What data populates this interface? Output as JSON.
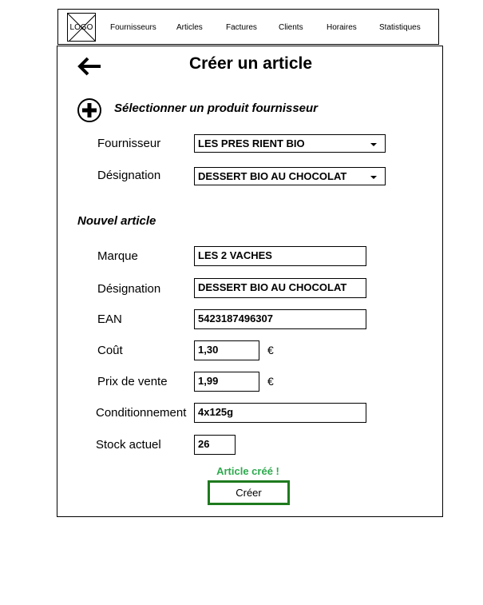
{
  "nav": {
    "logo": "LOGO",
    "items": [
      "Fournisseurs",
      "Articles",
      "Factures",
      "Clients",
      "Horaires",
      "Statistiques"
    ]
  },
  "page": {
    "title": "Créer un article"
  },
  "supplier_section": {
    "title": "Sélectionner un produit fournisseur",
    "fournisseur_label": "Fournisseur",
    "fournisseur_value": "LES PRES RIENT BIO",
    "designation_label": "Désignation",
    "designation_value": "DESSERT BIO AU CHOCOLAT"
  },
  "new_article": {
    "title": "Nouvel article",
    "marque_label": "Marque",
    "marque_value": "LES 2 VACHES",
    "designation_label": "Désignation",
    "designation_value": "DESSERT BIO AU CHOCOLAT",
    "ean_label": "EAN",
    "ean_value": "5423187496307",
    "cout_label": "Coût",
    "cout_value": "1,30",
    "cout_unit": "€",
    "prix_label": "Prix de vente",
    "prix_value": "1,99",
    "prix_unit": "€",
    "conditionnement_label": "Conditionnement",
    "conditionnement_value": "4x125g",
    "stock_label": "Stock actuel",
    "stock_value": "26"
  },
  "status_message": "Article créé !",
  "create_button": "Créer",
  "colors": {
    "status_green": "#2eaa4e",
    "button_border": "#1e7a1e"
  }
}
